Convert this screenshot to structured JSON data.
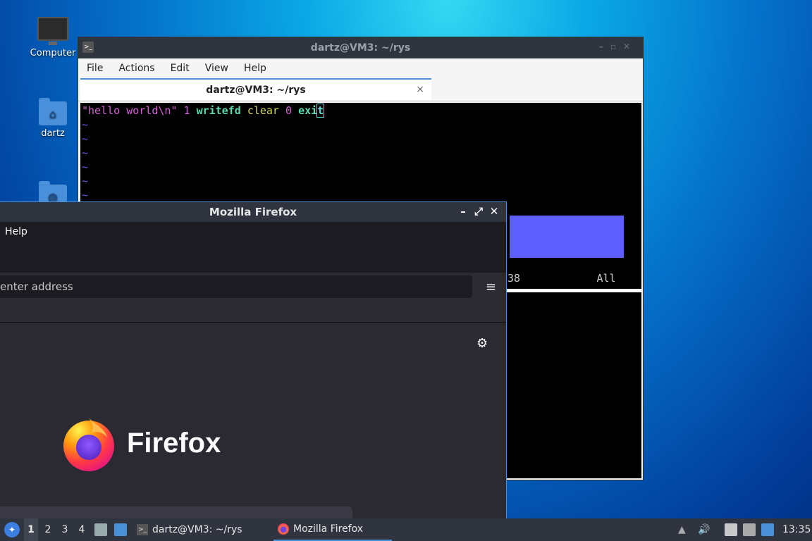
{
  "desktop": {
    "icons": [
      {
        "label": "Computer",
        "icon": "computer-icon"
      },
      {
        "label": "dartz",
        "icon": "home-folder-icon"
      },
      {
        "label": "",
        "icon": "network-folder-icon"
      }
    ]
  },
  "terminal": {
    "title": "dartz@VM3: ~/rys",
    "menu": [
      "File",
      "Actions",
      "Edit",
      "View",
      "Help"
    ],
    "tab_label": "dartz@VM3: ~/rys",
    "tab_close": "×",
    "code": {
      "str": "\"hello world\\n\"",
      "n1": "1",
      "writefd": "writefd",
      "clear": "clear",
      "n0": "0",
      "exi": "exi",
      "t": "t"
    },
    "tilde": "~",
    "status_pos": "38",
    "status_all": "All"
  },
  "firefox": {
    "title": "Mozilla Firefox",
    "menu_help": "Help",
    "address_placeholder": "enter address",
    "wordmark": "Firefox"
  },
  "taskbar": {
    "workspaces": [
      "1",
      "2",
      "3",
      "4"
    ],
    "tasks": [
      {
        "label": "dartz@VM3: ~/rys",
        "icon": "terminal-icon"
      },
      {
        "label": "Mozilla Firefox",
        "icon": "firefox-icon"
      }
    ],
    "clock": "13:35"
  }
}
